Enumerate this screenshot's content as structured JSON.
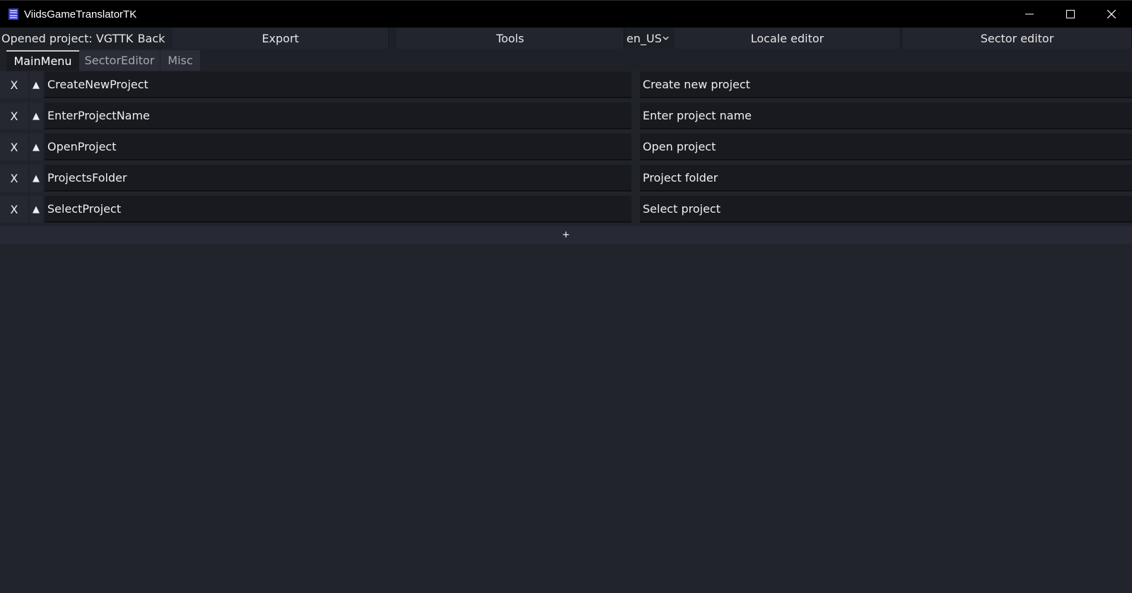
{
  "window": {
    "title": "ViidsGameTranslatorTK",
    "icon": "app-menu-icon",
    "controls": [
      "minimize-icon",
      "maximize-icon",
      "close-icon"
    ]
  },
  "menubar": {
    "project_label": "Opened project: VGTTK",
    "back": "Back",
    "export": "Export",
    "tools": "Tools",
    "locale_select": "en_US",
    "locale_editor": "Locale editor",
    "sector_editor": "Sector editor"
  },
  "tabs": [
    {
      "label": "MainMenu",
      "active": true
    },
    {
      "label": "SectorEditor",
      "active": false
    },
    {
      "label": "Misc",
      "active": false
    }
  ],
  "entries": [
    {
      "delete": "X",
      "move_up": "▲",
      "key": "CreateNewProject",
      "value": "Create new project"
    },
    {
      "delete": "X",
      "move_up": "▲",
      "key": "EnterProjectName",
      "value": "Enter project name"
    },
    {
      "delete": "X",
      "move_up": "▲",
      "key": "OpenProject",
      "value": "Open project"
    },
    {
      "delete": "X",
      "move_up": "▲",
      "key": "ProjectsFolder",
      "value": "Project folder"
    },
    {
      "delete": "X",
      "move_up": "▲",
      "key": "SelectProject",
      "value": "Select project"
    }
  ],
  "add_entry": "+",
  "colors": {
    "background": "#20232a",
    "titlebar": "#000000",
    "field": "#181a20",
    "text": "#e6e6e6"
  }
}
